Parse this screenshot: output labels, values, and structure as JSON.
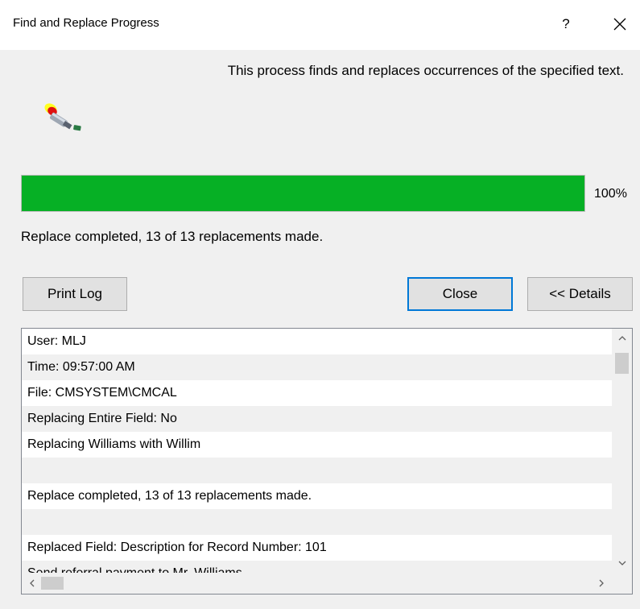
{
  "window": {
    "title": "Find and Replace Progress",
    "help_label": "?"
  },
  "description": "This process finds and replaces occurrences of the specified text.",
  "progress": {
    "value": 100,
    "percent_label": "100%",
    "fill_color": "#06b025"
  },
  "status": "Replace completed, 13 of 13 replacements made.",
  "buttons": {
    "print_log": "Print Log",
    "close": "Close",
    "details": "<< Details"
  },
  "log": {
    "lines": [
      "User: MLJ",
      "Time: 09:57:00 AM",
      "File: CMSYSTEM\\CMCAL",
      "Replacing Entire Field: No",
      "Replacing Williams with Willim",
      "",
      "Replace completed, 13 of 13 replacements made.",
      "",
      "Replaced Field: Description for Record Number: 101",
      "   Send referral payment to Mr. Williams"
    ]
  },
  "icons": {
    "app": "flashlight-search-icon",
    "close": "close-icon"
  }
}
